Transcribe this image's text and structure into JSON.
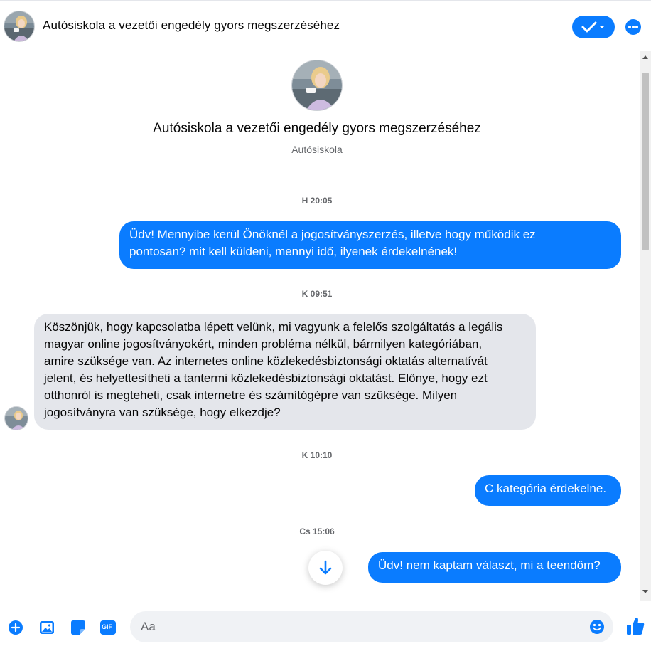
{
  "header": {
    "title": "Autósiskola a vezetői engedély gyors megszerzéséhez"
  },
  "profile": {
    "name": "Autósiskola a vezetői engedély gyors megszerzéséhez",
    "subtitle": "Autósiskola"
  },
  "messages": [
    {
      "type": "time",
      "text": "H 20:05"
    },
    {
      "type": "out",
      "lines": [
        "Üdv! Mennyibe kerül Önöknél a jogosítványszerzés, illetve hogy működik ez",
        "pontosan? mit kell küldeni, mennyi idő, ilyenek érdekelnének!"
      ]
    },
    {
      "type": "time",
      "text": "K 09:51"
    },
    {
      "type": "in",
      "lines": [
        "Köszönjük, hogy kapcsolatba lépett velünk, mi vagyunk a felelős szolgáltatás a legális",
        "magyar online jogosítványokért, minden probléma nélkül, bármilyen kategóriában,",
        "amire szüksége van. Az internetes online közlekedésbiztonsági oktatás alternatívát",
        "jelent, és helyettesítheti a tantermi közlekedésbiztonsági oktatást. Előnye, hogy ezt",
        "otthonról is megteheti, csak internetre és számítógépre van szüksége. Milyen",
        "jogosítványra van szüksége, hogy elkezdje?"
      ]
    },
    {
      "type": "time",
      "text": "K 10:10"
    },
    {
      "type": "out",
      "lines": [
        "C kategória érdekelne."
      ]
    },
    {
      "type": "time",
      "text": "Cs 15:06"
    },
    {
      "type": "out",
      "lines": [
        "Üdv! nem kaptam választ, mi a teendőm?"
      ]
    }
  ],
  "composer": {
    "placeholder": "Aa",
    "gif_label": "GIF"
  },
  "colors": {
    "accent": "#0a7cff",
    "incoming_bubble": "#e4e6eb",
    "composer_bg": "#f0f2f5"
  },
  "icons": [
    "avatar",
    "check-icon",
    "chevron-down-icon",
    "more-icon",
    "arrow-down-icon",
    "plus-icon",
    "image-icon",
    "sticker-icon",
    "gif-icon",
    "emoji-icon",
    "thumbs-up-icon"
  ]
}
